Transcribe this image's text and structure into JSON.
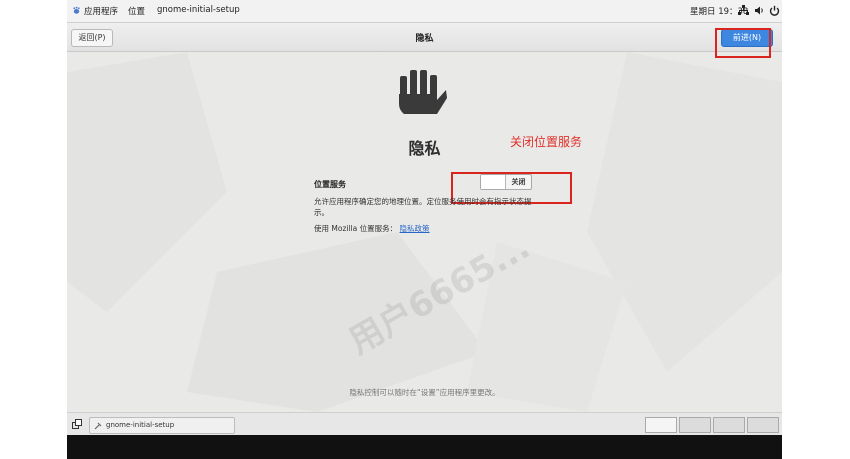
{
  "topbar": {
    "apps": "应用程序",
    "places": "位置",
    "app_name": "gnome-initial-setup",
    "datetime": "星期日 19：38"
  },
  "header": {
    "back_label": "返回(P)",
    "title": "隐私",
    "next_label": "前进(N)"
  },
  "privacy": {
    "title": "隐私",
    "annotation": "关闭位置服务",
    "location_label": "位置服务",
    "location_switch_state": "关闭",
    "description": "允许应用程序确定您的地理位置。定位服务使用时会有指示状态提示。",
    "mozilla_text": "使用 Mozilla 位置服务：",
    "privacy_policy_link": "隐私政策",
    "footer_note": "隐私控制可以随时在“设置”应用程序里更改。",
    "watermark": "用户6665..."
  },
  "taskbar": {
    "task_label": "gnome-initial-setup"
  },
  "colors": {
    "accent": "#3d87e0",
    "annotation_red": "#e0302a"
  }
}
